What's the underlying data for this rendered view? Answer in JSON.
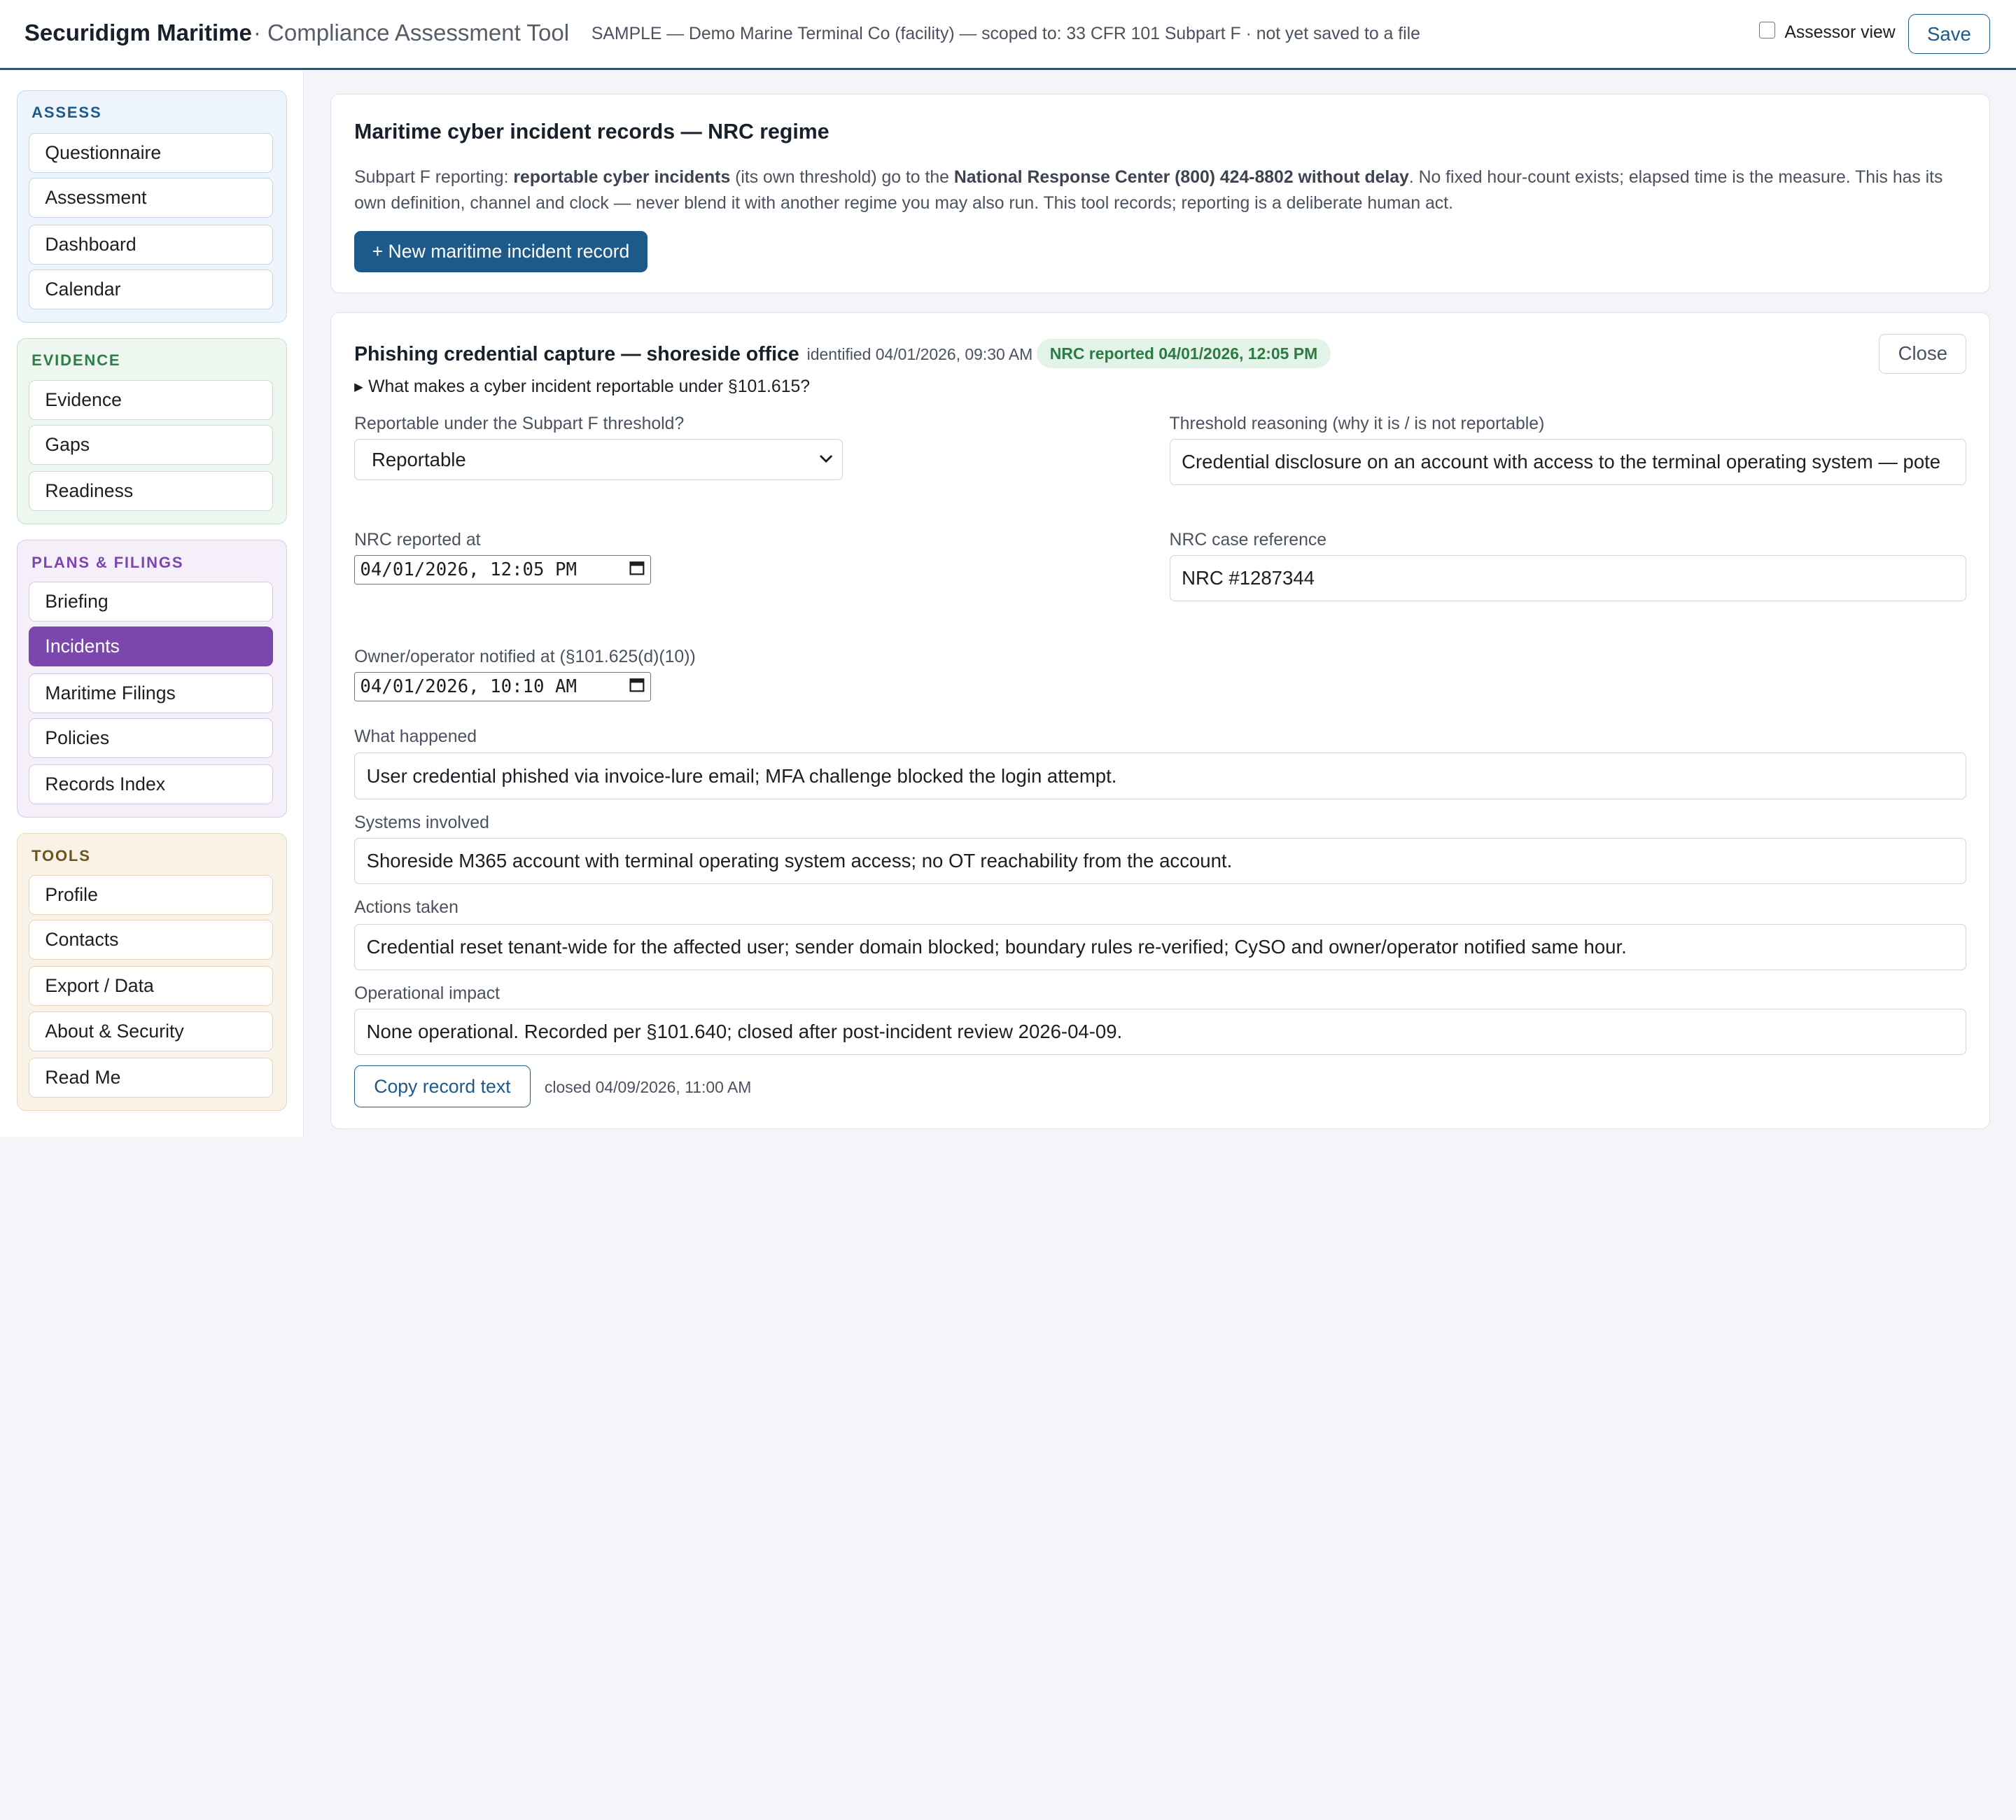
{
  "header": {
    "brand": "Securidigm Maritime",
    "brand_sub": "· Compliance Assessment Tool",
    "scope": "SAMPLE — Demo Marine Terminal Co (facility) — scoped to: 33 CFR 101 Subpart F · not yet saved to a file",
    "assessor_label": "Assessor view",
    "assessor_checked": false,
    "save_label": "Save"
  },
  "sidebar": {
    "assess": {
      "title": "ASSESS",
      "items": [
        "Questionnaire",
        "Assessment",
        "Dashboard",
        "Calendar"
      ]
    },
    "evidence": {
      "title": "EVIDENCE",
      "items": [
        "Evidence",
        "Gaps",
        "Readiness"
      ]
    },
    "plans": {
      "title": "PLANS & FILINGS",
      "items": [
        "Briefing",
        "Incidents",
        "Maritime Filings",
        "Policies",
        "Records Index"
      ],
      "active": "Incidents"
    },
    "tools": {
      "title": "TOOLS",
      "items": [
        "Profile",
        "Contacts",
        "Export / Data",
        "About & Security",
        "Read Me"
      ]
    }
  },
  "intro": {
    "title": "Maritime cyber incident records — NRC regime",
    "desc_1": "Subpart F reporting: ",
    "desc_b1": "reportable cyber incidents",
    "desc_2": " (its own threshold) go to the ",
    "desc_b2": "National Response Center (800) 424-8802 without delay",
    "desc_3": ". No fixed hour-count exists; elapsed time is the measure. This has its own definition, channel and clock — never blend it with another regime you may also run. This tool records; reporting is a deliberate human act.",
    "new_button": "+ New maritime incident record"
  },
  "incident": {
    "title": "Phishing credential capture — shoreside office",
    "identified": "identified 04/01/2026, 09:30 AM",
    "badge": "NRC reported 04/01/2026, 12:05 PM",
    "close_label": "Close",
    "details_summary": "What makes a cyber incident reportable under §101.615?",
    "reportable_label": "Reportable under the Subpart F threshold?",
    "reportable_value": "Reportable",
    "threshold_label": "Threshold reasoning (why it is / is not reportable)",
    "threshold_value": "Credential disclosure on an account with access to the terminal operating system — pote",
    "nrc_at_label": "NRC reported at",
    "nrc_at_value": "04/01/2026, 12:05 PM",
    "nrc_ref_label": "NRC case reference",
    "nrc_ref_value": "NRC #1287344",
    "owner_label": "Owner/operator notified at (§101.625(d)(10))",
    "owner_value": "04/01/2026, 10:10 AM",
    "what_label": "What happened",
    "what_value": "User credential phished via invoice-lure email; MFA challenge blocked the login attempt.",
    "systems_label": "Systems involved",
    "systems_value": "Shoreside M365 account with terminal operating system access; no OT reachability from the account.",
    "actions_label": "Actions taken",
    "actions_value": "Credential reset tenant-wide for the affected user; sender domain blocked; boundary rules re-verified; CySO and owner/operator notified same hour.",
    "impact_label": "Operational impact",
    "impact_value": "None operational. Recorded per §101.640; closed after post-incident review 2026-04-09.",
    "copy_label": "Copy record text",
    "closed_note": "closed 04/09/2026, 11:00 AM"
  },
  "colors": {
    "primary": "#1d5a8a",
    "active_nav": "#7b47ad",
    "badge_bg": "#e3f3e7",
    "badge_fg": "#2c7a44"
  }
}
